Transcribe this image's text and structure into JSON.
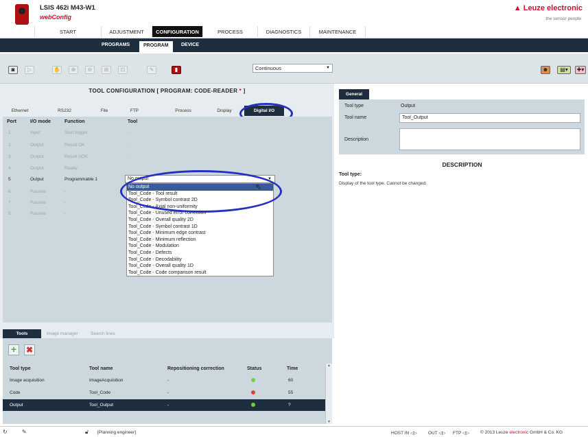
{
  "header": {
    "model": "LSIS 462i M43-W1",
    "app_name": "webConfig",
    "brand": "Leuze electronic",
    "brand_icon": "triangle-warning-icon",
    "tagline": "the sensor people"
  },
  "main_nav": [
    "START",
    "ADJUSTMENT",
    "CONFIGURATION",
    "PROCESS",
    "DIAGNOSTICS",
    "MAINTENANCE"
  ],
  "main_nav_active": "CONFIGURATION",
  "sub_nav": [
    "PROGRAMS",
    "PROGRAM",
    "DEVICE"
  ],
  "sub_nav_active": "PROGRAM",
  "toolbar": {
    "icons": [
      "camera-icon",
      "play-icon",
      "hand-icon",
      "zoom-in-icon",
      "zoom-out-icon",
      "zoom-fit-icon",
      "zoom-region-icon",
      "pipette-icon",
      "save-to-device-icon"
    ],
    "mode": "Continuous",
    "right_icons": [
      "users-icon",
      "export-icon",
      "language-flag-icon"
    ]
  },
  "config": {
    "title_prefix": "TOOL CONFIGURATION   [ PROGRAM: CODE-READER ",
    "title_star": "*",
    "title_suffix": " ]",
    "interface_tabs": [
      "Ethernet",
      "RS232",
      "File",
      "FTP",
      "Process",
      "Display",
      "Digital I/O"
    ],
    "active_tab": "Digital I/O"
  },
  "io_table": {
    "headers": [
      "Port",
      "I/O mode",
      "Function",
      "Tool"
    ],
    "rows": [
      {
        "port": "1",
        "mode": "Input",
        "function": "Start trigger",
        "tool": "-"
      },
      {
        "port": "2",
        "mode": "Output",
        "function": "Result OK",
        "tool": "-"
      },
      {
        "port": "3",
        "mode": "Output",
        "function": "Result NOK",
        "tool": "-"
      },
      {
        "port": "4",
        "mode": "Output",
        "function": "Ready",
        "tool": ""
      },
      {
        "port": "5",
        "mode": "Output",
        "function": "Programmable 1",
        "tool": ""
      },
      {
        "port": "6",
        "mode": "Passive",
        "function": "-",
        "tool": ""
      },
      {
        "port": "7",
        "mode": "Passive",
        "function": "-",
        "tool": ""
      },
      {
        "port": "8",
        "mode": "Passive",
        "function": "-",
        "tool": ""
      }
    ]
  },
  "tool_dropdown": {
    "value": "No output",
    "options": [
      "No output",
      "Tool_Code - Tool result",
      "Tool_Code - Symbol contrast 2D",
      "Tool_Code - Axial non-uniformity",
      "Tool_Code - Unused error correction",
      "Tool_Code - Overall quality 2D",
      "Tool_Code - Symbol contrast 1D",
      "Tool_Code - Minimum edge contrast",
      "Tool_Code - Minimum reflection",
      "Tool_Code - Modulation",
      "Tool_Code - Defects",
      "Tool_Code - Decodability",
      "Tool_Code - Overall quality 1D",
      "Tool_Code - Code comparison result"
    ],
    "highlight_color": "#3a5a9c"
  },
  "general": {
    "tab": "General",
    "tool_type_label": "Tool type",
    "tool_type_value": "Output",
    "tool_name_label": "Tool name",
    "tool_name_value": "Tool_Output",
    "description_label": "Description"
  },
  "description": {
    "title": "DESCRIPTION",
    "label": "Tool type:",
    "text": "Display of the tool type. Cannot be changed."
  },
  "tools_panel": {
    "tabs": [
      "Tools",
      "Image manager",
      "Search lines"
    ],
    "active_tab": "Tools",
    "headers": [
      "Tool type",
      "Tool name",
      "Repositioning correction",
      "Status",
      "Time"
    ],
    "rows": [
      {
        "type": "Image acquisition",
        "name": "ImageAcquisition",
        "repos": "-",
        "status": "green",
        "time": "60"
      },
      {
        "type": "Code",
        "name": "Tool_Code",
        "repos": "-",
        "status": "red",
        "time": "55"
      },
      {
        "type": "Output",
        "name": "Tool_Output",
        "repos": "-",
        "status": "green",
        "time": "?"
      }
    ],
    "selected_row": "Output"
  },
  "status_bar": {
    "user": "[Planning engineer]",
    "host_in": "HOST IN",
    "out": "OUT",
    "ftp": "FTP",
    "copyright_prefix": "© 2013 Leuze ",
    "copyright_red": "electronic",
    "copyright_suffix": " GmbH & Co. KG"
  },
  "colors": {
    "brand_red": "#c8102e",
    "dark_nav": "#1f2e3f",
    "panel_bg": "#ccd8dd",
    "annotation_blue": "#2430c0"
  }
}
